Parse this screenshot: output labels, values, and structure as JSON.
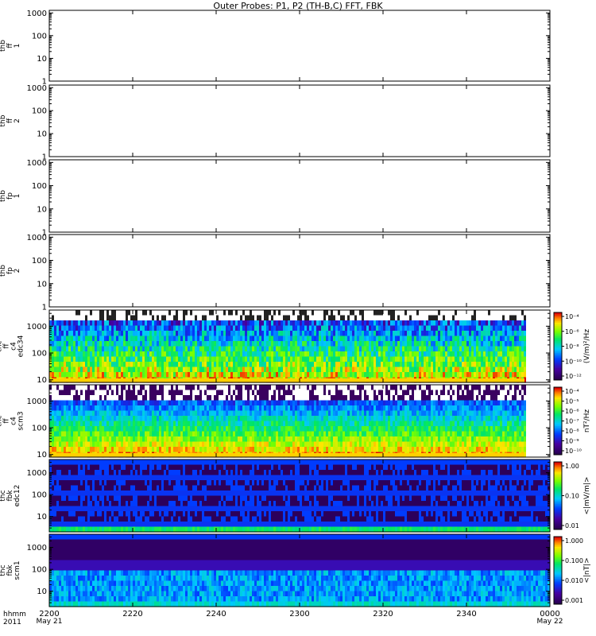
{
  "title": "Outer Probes: P1, P2 (TH-B,C) FFT, FBK",
  "time_axis": {
    "label_lines": [
      "hhmm",
      "2011"
    ],
    "ticks": [
      "2200",
      "2220",
      "2240",
      "2300",
      "2320",
      "2340",
      "0000"
    ],
    "date_start": "May 21",
    "date_end": "May 22"
  },
  "chart_data": [
    {
      "type": "heatmap",
      "ylabel": [
        "thb",
        "ff",
        "1"
      ],
      "log_y": true,
      "yticks": [
        "1",
        "10",
        "100",
        "1000"
      ],
      "ylim": [
        1,
        1300
      ],
      "has_data": false
    },
    {
      "type": "heatmap",
      "ylabel": [
        "thb",
        "ff",
        "2"
      ],
      "log_y": true,
      "yticks": [
        "1",
        "10",
        "100",
        "1000"
      ],
      "ylim": [
        1,
        1300
      ],
      "has_data": false
    },
    {
      "type": "heatmap",
      "ylabel": [
        "thb",
        "fp",
        "1"
      ],
      "log_y": true,
      "yticks": [
        "1",
        "10",
        "100",
        "1000"
      ],
      "ylim": [
        1,
        1300
      ],
      "has_data": false
    },
    {
      "type": "heatmap",
      "ylabel": [
        "thb",
        "fp",
        "2"
      ],
      "log_y": true,
      "yticks": [
        "1",
        "10",
        "100",
        "1000"
      ],
      "ylim": [
        1,
        1300
      ],
      "has_data": false
    },
    {
      "type": "heatmap",
      "ylabel": [
        "thc",
        "ff",
        "c4",
        "edc34"
      ],
      "log_y": true,
      "yticks": [
        "10",
        "100",
        "1000"
      ],
      "ylim": [
        8,
        4000
      ],
      "has_data": true,
      "colorbar": {
        "label": "(V/m)²/Hz",
        "ticks": [
          "10⁻⁴",
          "10⁻⁶",
          "10⁻⁸",
          "10⁻¹⁰",
          "10⁻¹²"
        ]
      }
    },
    {
      "type": "heatmap",
      "ylabel": [
        "thc",
        "ff",
        "c4",
        "scm3"
      ],
      "log_y": true,
      "yticks": [
        "10",
        "100",
        "1000"
      ],
      "ylim": [
        8,
        4000
      ],
      "has_data": true,
      "colorbar": {
        "label": "nT²/Hz",
        "ticks": [
          "10⁻⁴",
          "10⁻⁵",
          "10⁻⁶",
          "10⁻⁷",
          "10⁻⁸",
          "10⁻⁹",
          "10⁻¹⁰"
        ]
      }
    },
    {
      "type": "heatmap",
      "ylabel": [
        "thc",
        "fbk",
        "edc12"
      ],
      "log_y": true,
      "yticks": [
        "10",
        "100",
        "1000"
      ],
      "ylim": [
        2,
        4000
      ],
      "has_data": true,
      "colorbar": {
        "label": "<|mV/m|>",
        "ticks": [
          "1.00",
          "0.10",
          "0.01"
        ]
      }
    },
    {
      "type": "heatmap",
      "ylabel": [
        "thc",
        "fbk",
        "scm1"
      ],
      "log_y": true,
      "yticks": [
        "10",
        "100",
        "1000"
      ],
      "ylim": [
        2,
        4000
      ],
      "has_data": true,
      "colorbar": {
        "label": "<|nT|>",
        "ticks": [
          "1.000",
          "0.100",
          "0.010",
          "0.001"
        ]
      }
    }
  ]
}
